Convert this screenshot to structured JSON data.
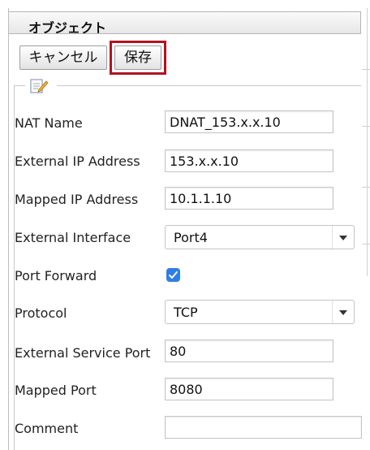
{
  "panel": {
    "title": "オブジェクト"
  },
  "toolbar": {
    "cancel_label": "キャンセル",
    "save_label": "保存"
  },
  "form": {
    "nat_name": {
      "label": "NAT Name",
      "value": "DNAT_153.x.x.10"
    },
    "external_ip": {
      "label": "External IP Address",
      "value": "153.x.x.10"
    },
    "mapped_ip": {
      "label": "Mapped IP Address",
      "value": "10.1.1.10"
    },
    "external_interface": {
      "label": "External Interface",
      "value": "Port4"
    },
    "port_forward": {
      "label": "Port Forward",
      "checked": true
    },
    "protocol": {
      "label": "Protocol",
      "value": "TCP"
    },
    "external_service_port": {
      "label": "External Service Port",
      "value": "80"
    },
    "mapped_port": {
      "label": "Mapped Port",
      "value": "8080"
    },
    "comment": {
      "label": "Comment",
      "value": ""
    }
  },
  "icons": {
    "legend": "edit-note-icon",
    "checkbox": "checkmark-icon",
    "dropdown": "chevron-down-icon"
  },
  "colors": {
    "highlight": "#b3121f",
    "checkbox": "#2f7ee6"
  }
}
